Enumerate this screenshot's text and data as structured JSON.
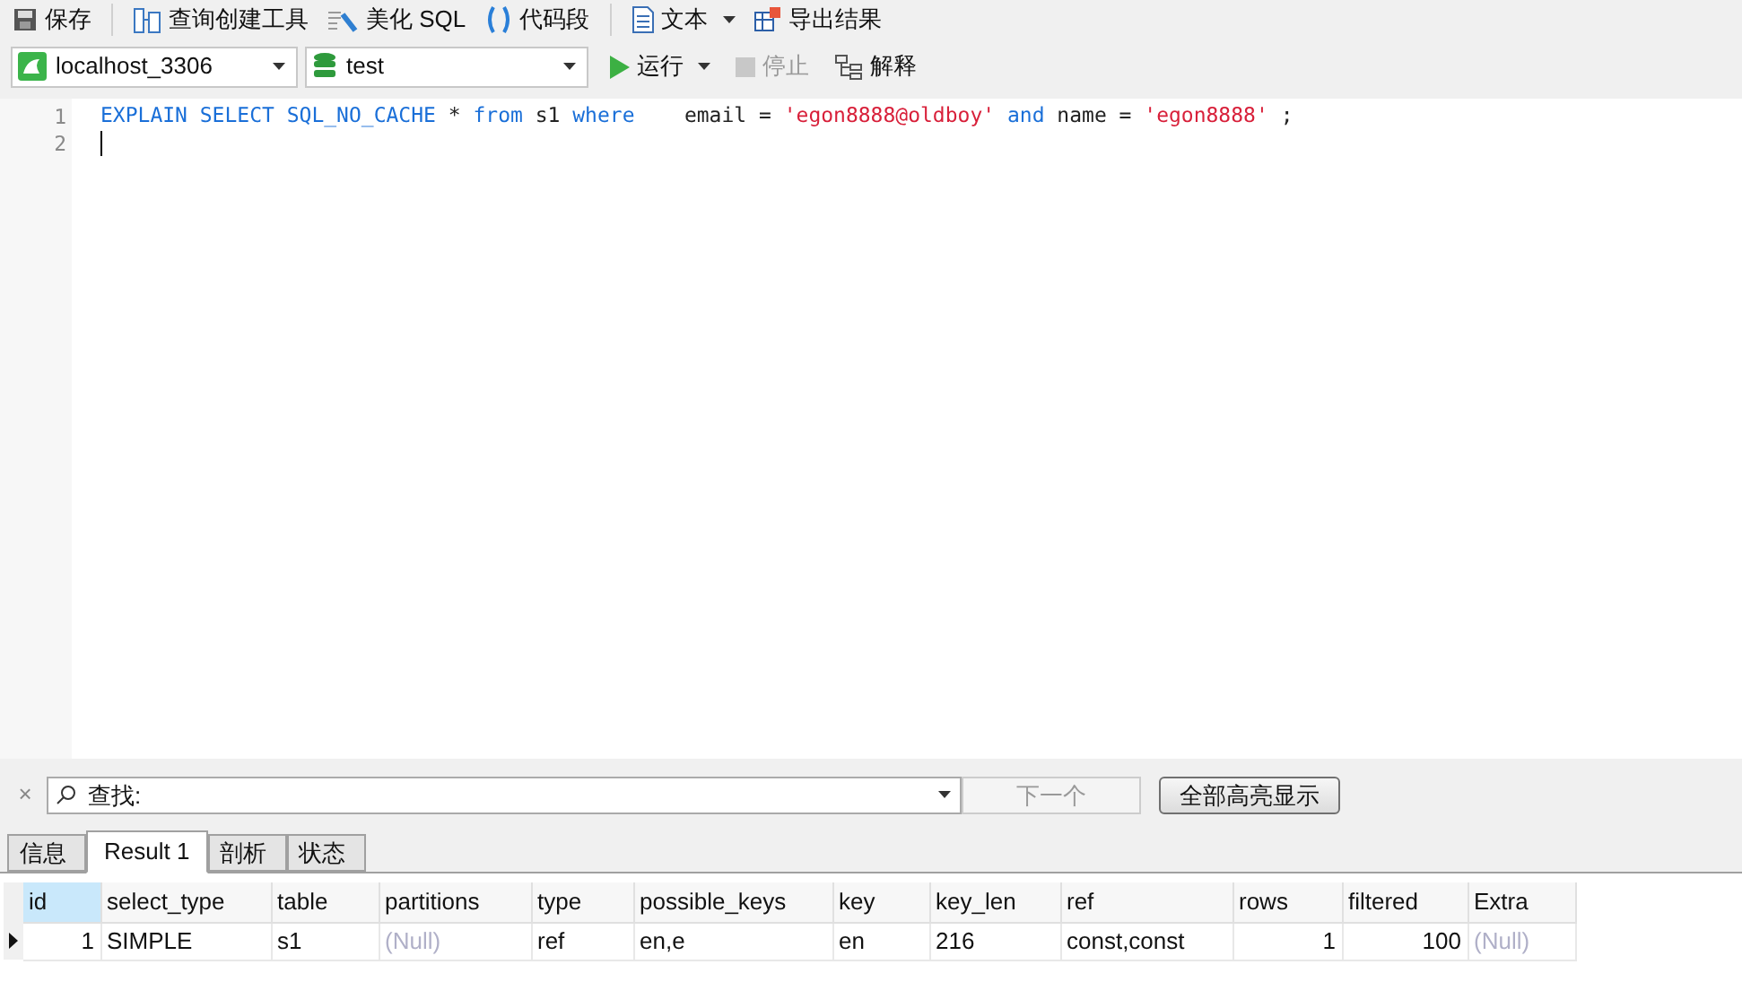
{
  "toolbar": [
    {
      "kind": "save",
      "label": "保存"
    },
    {
      "kind": "query-builder",
      "label": "查询创建工具"
    },
    {
      "kind": "beautify",
      "label": "美化 SQL"
    },
    {
      "kind": "snippet",
      "label": "代码段"
    },
    {
      "kind": "text",
      "label": "文本",
      "dropdown": true
    },
    {
      "kind": "export",
      "label": "导出结果"
    }
  ],
  "connection": {
    "value": "localhost_3306"
  },
  "database": {
    "value": "test"
  },
  "actions": [
    {
      "kind": "run",
      "label": "运行",
      "disabled": false,
      "dropdown": true
    },
    {
      "kind": "stop",
      "label": "停止",
      "disabled": true,
      "dropdown": false
    },
    {
      "kind": "explain",
      "label": "解释",
      "disabled": false,
      "dropdown": false
    }
  ],
  "editor": {
    "lines": [
      {
        "number": "1",
        "tokens": [
          {
            "kind": "keyword",
            "text": "EXPLAIN SELECT SQL_NO_CACHE"
          },
          {
            "kind": "plain",
            "text": " * "
          },
          {
            "kind": "keyword",
            "text": "from"
          },
          {
            "kind": "plain",
            "text": " s1 "
          },
          {
            "kind": "keyword",
            "text": "where"
          },
          {
            "kind": "plain",
            "text": "    email = "
          },
          {
            "kind": "string",
            "text": "'egon8888@oldboy'"
          },
          {
            "kind": "keyword",
            "text": "and"
          },
          {
            "kind": "plain",
            "text": " name = "
          },
          {
            "kind": "string",
            "text": "'egon8888'"
          },
          {
            "kind": "plain",
            "text": " ;"
          }
        ]
      },
      {
        "number": "2",
        "cursor": true
      }
    ]
  },
  "find_bar": {
    "close": "×",
    "placeholder": "查找:",
    "next": "下一个",
    "highlight_all": "全部高亮显示"
  },
  "tabs": [
    {
      "label": "信息",
      "selected": false
    },
    {
      "label": "Result 1",
      "selected": true
    },
    {
      "label": "剖析",
      "selected": false
    },
    {
      "label": "状态",
      "selected": false
    }
  ],
  "table": {
    "columns": [
      {
        "label": "id",
        "selected": true
      },
      {
        "label": "select_type",
        "selected": false
      },
      {
        "label": "table",
        "selected": false
      },
      {
        "label": "partitions",
        "selected": false
      },
      {
        "label": "type",
        "selected": false
      },
      {
        "label": "possible_keys",
        "selected": false
      },
      {
        "label": "key",
        "selected": false
      },
      {
        "label": "key_len",
        "selected": false
      },
      {
        "label": "ref",
        "selected": false
      },
      {
        "label": "rows",
        "selected": false
      },
      {
        "label": "filtered",
        "selected": false
      },
      {
        "label": "Extra",
        "selected": false
      }
    ],
    "rows": [
      {
        "current": true,
        "cells": [
          {
            "kind": "number",
            "text": "1"
          },
          {
            "kind": "text",
            "text": "SIMPLE"
          },
          {
            "kind": "text",
            "text": "s1"
          },
          {
            "kind": "null",
            "text": "(Null)"
          },
          {
            "kind": "text",
            "text": "ref"
          },
          {
            "kind": "text",
            "text": "en,e"
          },
          {
            "kind": "text",
            "text": "en"
          },
          {
            "kind": "text",
            "text": "216"
          },
          {
            "kind": "text",
            "text": "const,const"
          },
          {
            "kind": "number",
            "text": "1"
          },
          {
            "kind": "number",
            "text": "100"
          },
          {
            "kind": "null",
            "text": "(Null)"
          }
        ]
      }
    ]
  }
}
